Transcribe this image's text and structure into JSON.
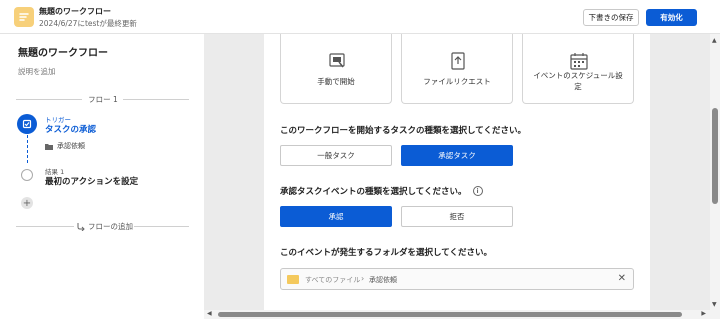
{
  "header": {
    "title": "無題のワークフロー",
    "subtitle": "2024/6/27にtestが最終更新",
    "save_draft": "下書きの保存",
    "enable": "有効化"
  },
  "sidebar": {
    "title": "無題のワークフロー",
    "description": "説明を追加",
    "flow_label": "フロー 1",
    "trigger_small": "トリガー",
    "trigger_name": "タスクの承認",
    "trigger_sub": "承認依頼",
    "result_small": "結果 1",
    "result_name": "最初のアクションを設定",
    "add_flow": "フローの追加"
  },
  "cards": [
    {
      "label": "手動で開始"
    },
    {
      "label": "ファイルリクエスト"
    },
    {
      "label_line1": "イベントのスケジュール設",
      "label_line2": "定"
    }
  ],
  "q1": {
    "text": "このワークフローを開始するタスクの種類を選択してください。",
    "option_general": "一般タスク",
    "option_approval": "承認タスク"
  },
  "q2": {
    "text": "承認タスクイベントの種類を選択してください。",
    "option_approve": "承認",
    "option_reject": "拒否"
  },
  "q3": {
    "text": "このイベントが発生するフォルダを選択してください。",
    "crumb_root": "すべてのファイル",
    "crumb_leaf": "承認依頼"
  },
  "colors": {
    "accent": "#0b5cd5",
    "app_icon": "#f7d07a",
    "folder": "#f4c95d"
  }
}
